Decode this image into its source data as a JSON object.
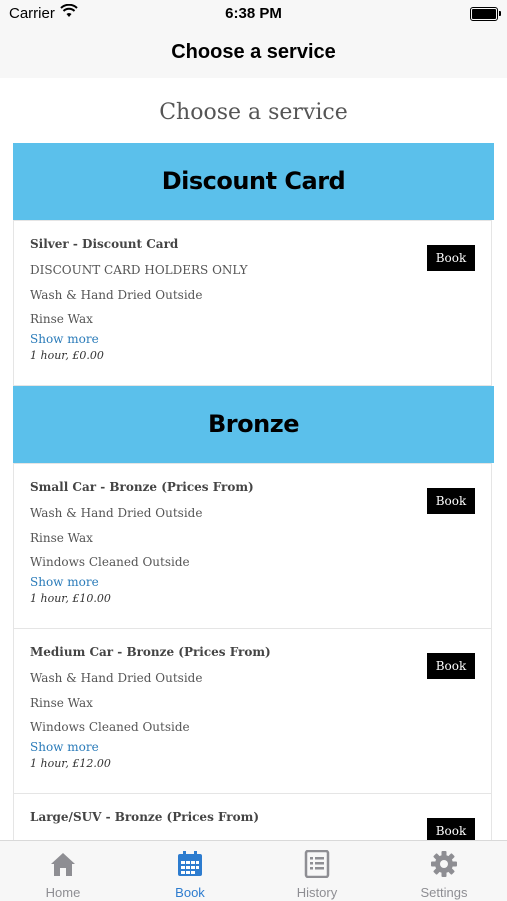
{
  "status_bar": {
    "carrier": "Carrier",
    "time": "6:38 PM"
  },
  "nav": {
    "title": "Choose a service"
  },
  "page": {
    "heading": "Choose a service"
  },
  "categories": [
    {
      "name": "Discount Card",
      "services": [
        {
          "title": "Silver - Discount Card",
          "lines": [
            "DISCOUNT CARD HOLDERS ONLY",
            "Wash & Hand Dried Outside",
            "Rinse Wax"
          ],
          "show_more": "Show more",
          "meta": "1 hour, £0.00",
          "book_label": "Book"
        }
      ]
    },
    {
      "name": "Bronze",
      "services": [
        {
          "title": "Small Car - Bronze (Prices From)",
          "lines": [
            "Wash & Hand Dried Outside",
            "Rinse Wax",
            "Windows Cleaned Outside"
          ],
          "show_more": "Show more",
          "meta": "1 hour, £10.00",
          "book_label": "Book"
        },
        {
          "title": "Medium Car - Bronze (Prices From)",
          "lines": [
            "Wash & Hand Dried Outside",
            "Rinse Wax",
            "Windows Cleaned Outside"
          ],
          "show_more": "Show more",
          "meta": "1 hour, £12.00",
          "book_label": "Book"
        },
        {
          "title": "Large/SUV - Bronze (Prices From)",
          "book_label": "Book"
        }
      ]
    }
  ],
  "tabs": [
    {
      "label": "Home",
      "icon": "home-icon"
    },
    {
      "label": "Book",
      "icon": "calendar-icon",
      "active": true
    },
    {
      "label": "History",
      "icon": "document-icon"
    },
    {
      "label": "Settings",
      "icon": "gear-icon"
    }
  ],
  "colors": {
    "category_bg": "#5bc0eb",
    "accent": "#2d7ccf",
    "book_bg": "#000000"
  }
}
